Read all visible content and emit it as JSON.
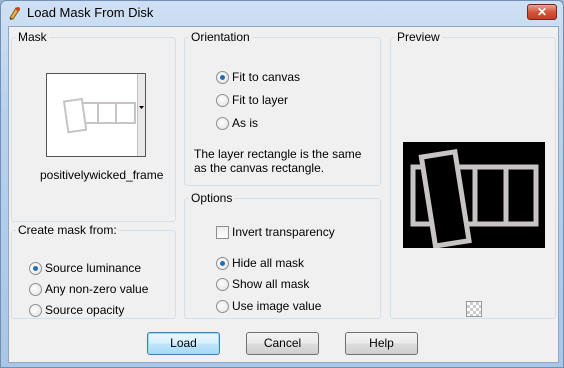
{
  "window": {
    "title": "Load Mask From Disk",
    "close_label": "✕"
  },
  "mask": {
    "legend": "Mask",
    "selected_mask": "positivelywicked_frame"
  },
  "create_mask_from": {
    "legend": "Create mask from:",
    "options": [
      "Source luminance",
      "Any non-zero value",
      "Source opacity"
    ],
    "selected": "Source luminance"
  },
  "orientation": {
    "legend": "Orientation",
    "options": [
      "Fit to canvas",
      "Fit to layer",
      "As is"
    ],
    "selected": "Fit to canvas",
    "description": "The layer rectangle is the same as the canvas rectangle."
  },
  "options": {
    "legend": "Options",
    "invert_transparency": {
      "label": "Invert transparency",
      "checked": false
    },
    "mask_modes": [
      "Hide all mask",
      "Show all mask",
      "Use image value"
    ],
    "selected_mode": "Hide all mask"
  },
  "preview": {
    "legend": "Preview"
  },
  "buttons": {
    "load": "Load",
    "cancel": "Cancel",
    "help": "Help"
  },
  "colors": {
    "accent": "#1f6fb5",
    "close_red": "#c33f25",
    "preview_bg": "#000000"
  }
}
